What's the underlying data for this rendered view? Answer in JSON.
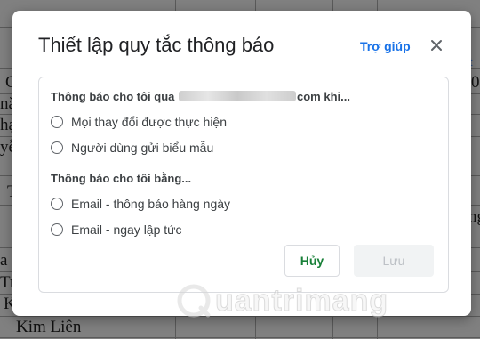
{
  "dialog": {
    "title": "Thiết lập quy tắc thông báo",
    "help_label": "Trợ giúp",
    "notify_when": {
      "prefix": "Thông báo cho tôi qua",
      "suffix": "com khi...",
      "options": [
        "Mọi thay đổi được thực hiện",
        "Người dùng gửi biểu mẫu"
      ]
    },
    "notify_how": {
      "title": "Thông báo cho tôi bằng...",
      "options": [
        "Email - thông báo hàng ngày",
        "Email - ngay lập tức"
      ]
    },
    "cancel_label": "Hủy",
    "save_label": "Lưu"
  },
  "background": {
    "fragments": [
      "C",
      "nă",
      "hạ",
      "yễ",
      "T",
      "a P",
      "Trầ",
      "K",
      "Kim Liên",
      "t",
      "0",
      "ng"
    ]
  },
  "watermark": {
    "text": "uantrimang"
  }
}
